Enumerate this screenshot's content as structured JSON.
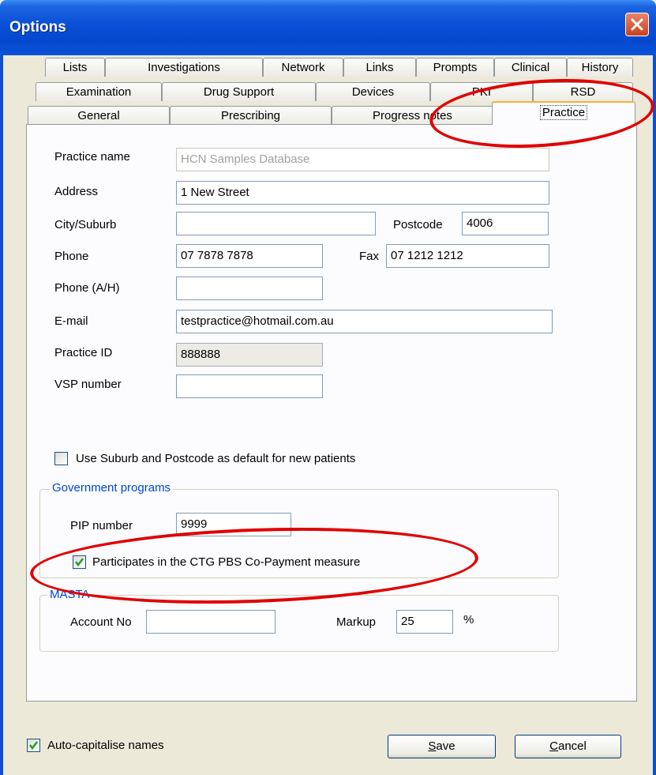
{
  "window": {
    "title": "Options"
  },
  "tabs": {
    "row1": [
      "Lists",
      "Investigations",
      "Network",
      "Links",
      "Prompts",
      "Clinical",
      "History"
    ],
    "row2": [
      "Examination",
      "Drug Support",
      "Devices",
      "PKI",
      "RSD"
    ],
    "row3": [
      "General",
      "Prescribing",
      "Progress notes",
      "Practice"
    ],
    "active": "Practice"
  },
  "practice": {
    "practice_name_label": "Practice name",
    "practice_name_value": "HCN Samples Database",
    "address_label": "Address",
    "address_value": "1 New Street",
    "city_label": "City/Suburb",
    "city_value": "",
    "postcode_label": "Postcode",
    "postcode_value": "4006",
    "phone_label": "Phone",
    "phone_value": "07 7878 7878",
    "fax_label": "Fax",
    "fax_value": "07 1212 1212",
    "phone_ah_label": "Phone (A/H)",
    "phone_ah_value": "",
    "email_label": "E-mail",
    "email_value": "testpractice@hotmail.com.au",
    "practice_id_label": "Practice ID",
    "practice_id_value": "888888",
    "vsp_label": "VSP number",
    "vsp_value": "",
    "use_suburb_label": "Use Suburb and Postcode as default for new patients",
    "use_suburb_checked": false
  },
  "government": {
    "title": "Government programs",
    "pip_label": "PIP number",
    "pip_value": "9999",
    "ctg_label": "Participates in the CTG PBS Co-Payment measure",
    "ctg_checked": true
  },
  "masta": {
    "title": "MASTA",
    "account_label": "Account No",
    "account_value": "",
    "markup_label": "Markup",
    "markup_value": "25",
    "percent": "%"
  },
  "footer": {
    "auto_cap_label": "Auto-capitalise names",
    "auto_cap_checked": true,
    "save_label": "ave",
    "save_mnemonic": "S",
    "cancel_label": "ancel",
    "cancel_mnemonic": "C"
  },
  "colors": {
    "accent": "#0a4fd6",
    "group_title": "#0046d5",
    "annotation": "#e00000"
  }
}
